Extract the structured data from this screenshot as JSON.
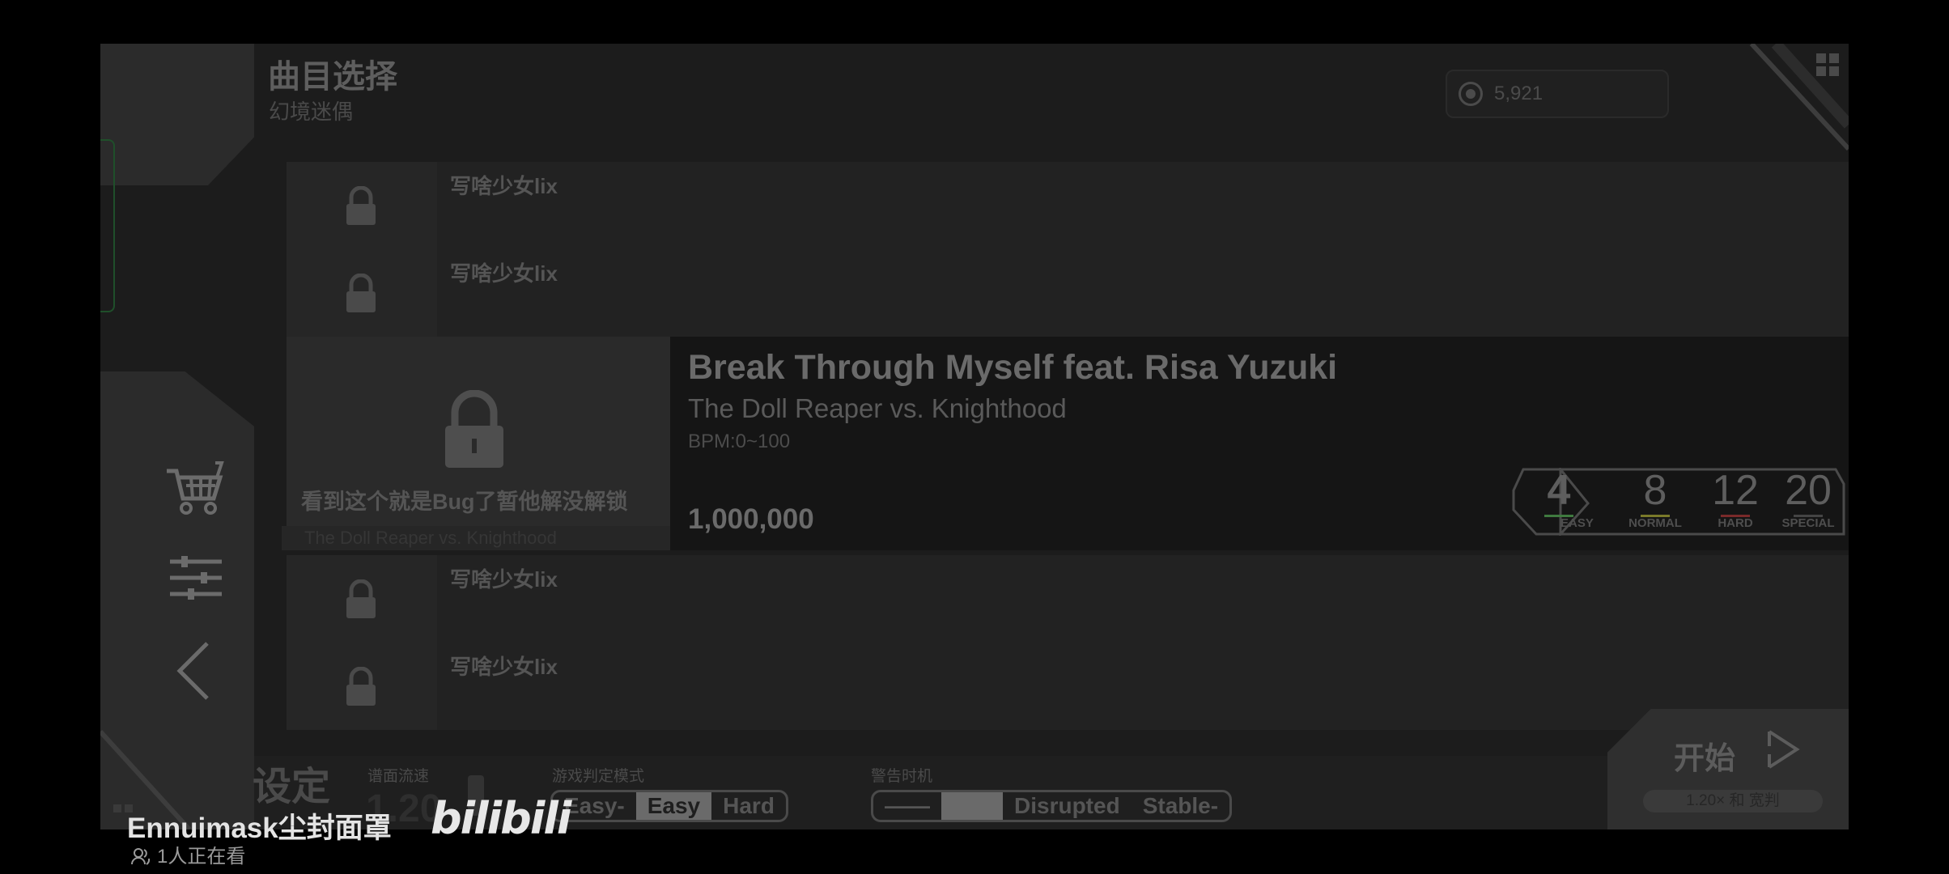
{
  "header": {
    "title": "曲目选择",
    "subtitle": "幻境迷偶",
    "coins": "5,921"
  },
  "song_list": [
    {
      "name": "写啥少女lix",
      "locked": true
    },
    {
      "name": "写啥少女lix",
      "locked": true
    },
    {
      "name": "写啥少女lix",
      "locked": true
    },
    {
      "name": "写啥少女lix",
      "locked": true
    }
  ],
  "selected_song": {
    "lock_text": "看到这个就是Bug了暂他解没解锁",
    "artist_strip": "The Doll Reaper vs. Knighthood",
    "title": "Break Through Myself feat. Risa Yuzuki",
    "artist": "The Doll Reaper vs. Knighthood",
    "bpm": "BPM:0~100",
    "score": "1,000,000",
    "difficulties": [
      {
        "level": "4",
        "label": "EASY",
        "color": "#3f7a3f"
      },
      {
        "level": "8",
        "label": "NORMAL",
        "color": "#7a7a2a"
      },
      {
        "level": "12",
        "label": "HARD",
        "color": "#7a2a2a"
      },
      {
        "level": "20",
        "label": "SPECIAL",
        "color": "#444444"
      }
    ]
  },
  "settings": {
    "label": "设定",
    "speed_label": "谱面流速",
    "speed_value": "1.20",
    "judge_label": "游戏判定模式",
    "judge_options": [
      "Easy-",
      "Easy",
      "Hard"
    ],
    "judge_selected": "Easy",
    "warning_label": "警告时机",
    "warning_options": [
      "——",
      "",
      "Disrupted",
      "Stable-"
    ],
    "warning_selected": ""
  },
  "start": {
    "label": "开始",
    "sub": "1.20× 和 宽判"
  },
  "overlay": {
    "uploader": "Ennuimask尘封面罩",
    "logo": "bilibili",
    "watching": "1人正在看"
  }
}
